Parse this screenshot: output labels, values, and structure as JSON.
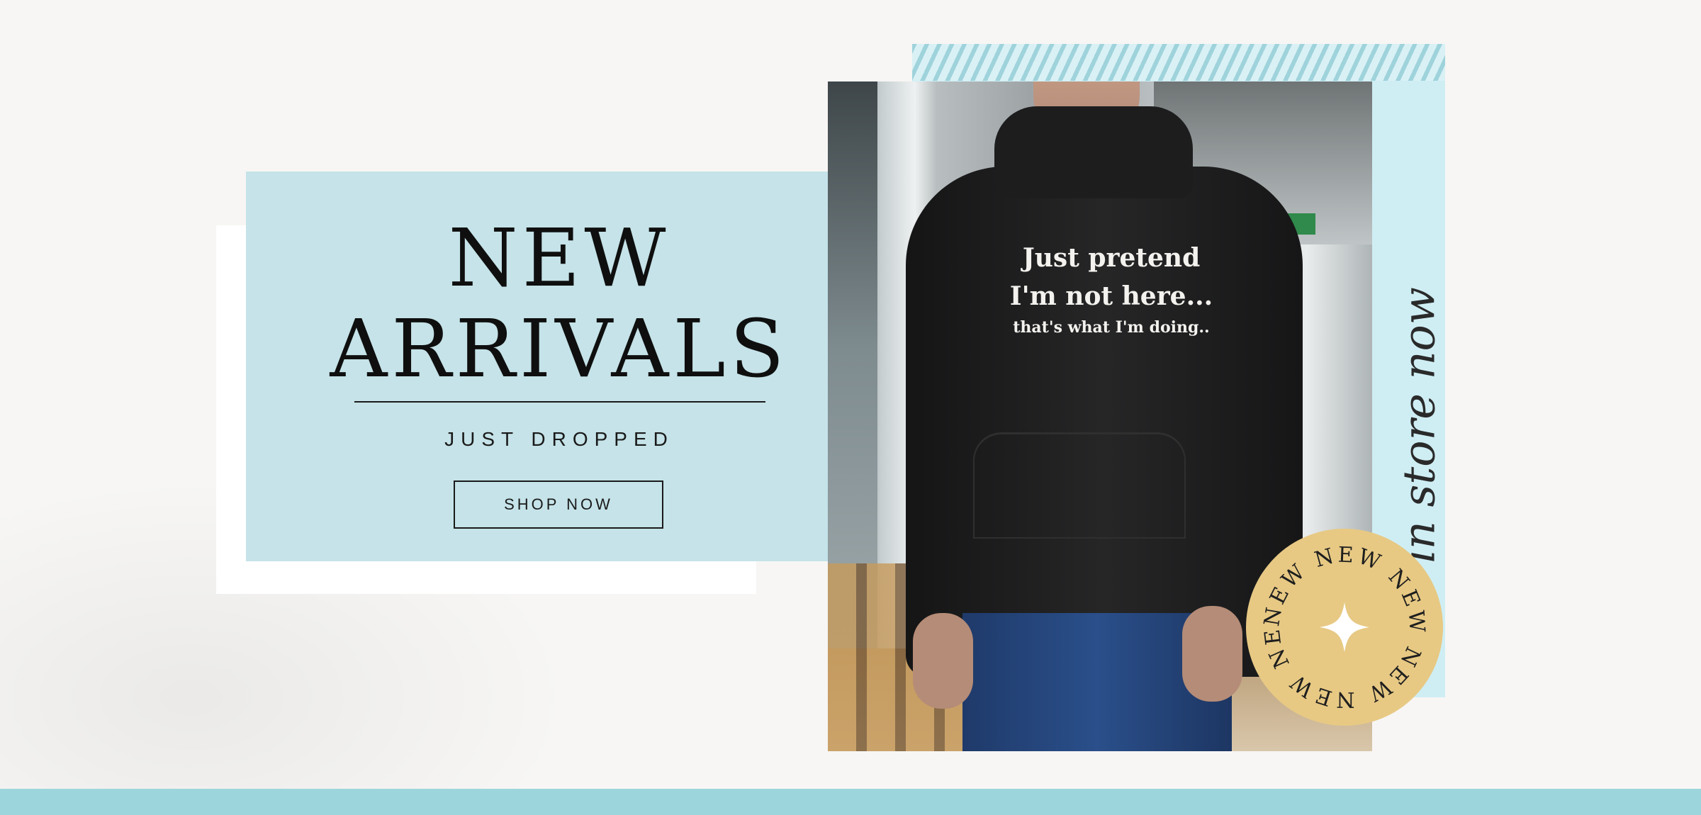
{
  "hero": {
    "title_line1": "NEW",
    "title_line2": "ARRIVALS",
    "tagline": "JUST DROPPED",
    "cta_label": "SHOP NOW"
  },
  "photo": {
    "shirt_line1": "Just pretend",
    "shirt_line2": "I'm not here...",
    "shirt_line3": "that's what I'm doing.."
  },
  "side_text": "in store now",
  "badge": {
    "ring_text": "NEW NEW NEW NEW NEW NEW ",
    "icon": "sparkle-icon"
  },
  "colors": {
    "card_blue": "#c5e3e8",
    "panel_blue": "#cfeef4",
    "badge_gold": "#e7c984",
    "bar_teal": "#9dd5dd"
  }
}
